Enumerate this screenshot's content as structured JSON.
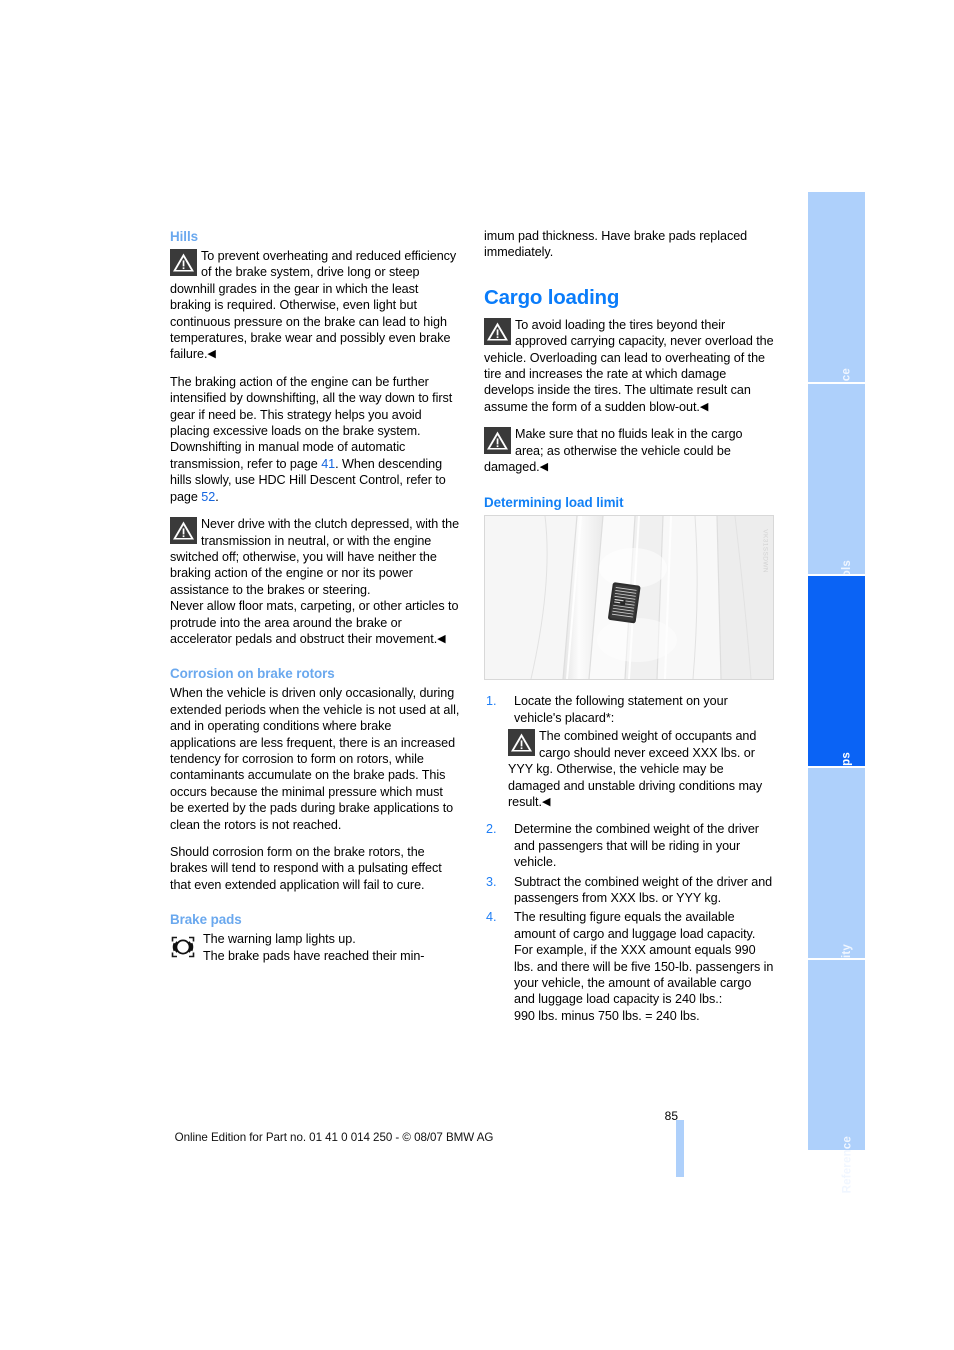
{
  "document": {
    "page_number": "85",
    "footer": "Online Edition for Part no. 01 41 0 014 250 - © 08/07 BMW AG"
  },
  "left_column": {
    "heading_hills": "Hills",
    "hills_warning": "To prevent overheating and reduced efficiency of the brake system, drive long or steep downhill grades in the gear in which the least braking is required. Otherwise, even light but continuous pressure on the brake can lead to high temperatures, brake wear and possibly even brake failure.",
    "downshifting_p1": "The braking action of the engine can be further intensified by downshifting, all the way down to first gear if need be. This strategy helps you avoid placing excessive loads on the brake system. Downshifting in manual mode of automatic transmission, refer to page ",
    "downshifting_ref1": "41",
    "downshifting_p2": ". When descending hills slowly, use HDC Hill Descent Control, refer to page ",
    "downshifting_ref2": "52",
    "downshifting_p3": ".",
    "clutch_warning": "Never drive with the clutch depressed, with the transmission in neutral, or with the engine switched off; otherwise, you will have neither the braking action of the engine or nor its power assistance to the brakes or steering.",
    "floor_mats_warning": "Never allow floor mats, carpeting, or other articles to protrude into the area around the brake or accelerator pedals and obstruct their movement.",
    "heading_corrosion": "Corrosion on brake rotors",
    "corrosion_p1": "When the vehicle is driven only occasionally, during extended periods when the vehicle is not used at all, and in operating conditions where brake applications are less frequent, there is an increased tendency for corrosion to form on rotors, while contaminants accumulate on the brake pads. This occurs because the minimal pressure which must be exerted by the pads during brake applications to clean the rotors is not reached.",
    "corrosion_p2": "Should corrosion form on the brake rotors, the brakes will tend to respond with a pulsating effect that even extended application will fail to cure.",
    "heading_brake_pads": "Brake pads",
    "brake_pads_note_line1": "The warning lamp lights up.",
    "brake_pads_note_line2": "The brake pads have reached their min-"
  },
  "right_column": {
    "continuation": "imum pad thickness. Have brake pads replaced immediately.",
    "heading_cargo": "Cargo loading",
    "cargo_warning_1": "To avoid loading the tires beyond their approved carrying capacity, never overload the vehicle. Overloading can lead to overheating of the tire and increases the rate at which damage develops inside the tires. The ultimate result can assume the form of a sudden blow-out.",
    "cargo_warning_2": "Make sure that no fluids leak in the cargo area; as otherwise the vehicle could be damaged.",
    "heading_load_limit": "Determining load limit",
    "figure": {
      "alt": "Vehicle door jamb with load placard",
      "credit": "VK31SSDWN"
    },
    "steps": [
      {
        "num": "1.",
        "text": "Locate the following statement on your vehicle's placard*:",
        "note": "The combined weight of occupants and cargo should never exceed XXX lbs. or YYY kg. Otherwise, the vehicle may be damaged and unstable driving conditions may result."
      },
      {
        "num": "2.",
        "text": "Determine the combined weight of the driver and passengers that will be riding in your vehicle."
      },
      {
        "num": "3.",
        "text": "Subtract the combined weight of the driver and passengers from XXX lbs. or YYY kg."
      },
      {
        "num": "4.",
        "text": "The resulting figure equals the available amount of cargo and luggage load capacity. For example, if the XXX amount equals 990 lbs. and there will be five 150-lb. passengers in your vehicle, the amount of available cargo and luggage load capacity is 240 lbs.:",
        "text2": "990 lbs. minus 750 lbs. = 240 lbs."
      }
    ]
  },
  "thumb_tabs": [
    {
      "label": "At a glance",
      "active": false
    },
    {
      "label": "Controls",
      "active": false
    },
    {
      "label": "Driving tips",
      "active": true
    },
    {
      "label": "Mobility",
      "active": false
    },
    {
      "label": "Reference",
      "active": false
    }
  ],
  "colors": {
    "heading_blue": "#0a7cfa",
    "subheading_blue": "#6aa8ee",
    "link_blue": "#1466e0",
    "tab_inactive": "#aed0fb",
    "tab_active": "#0a63f5"
  }
}
